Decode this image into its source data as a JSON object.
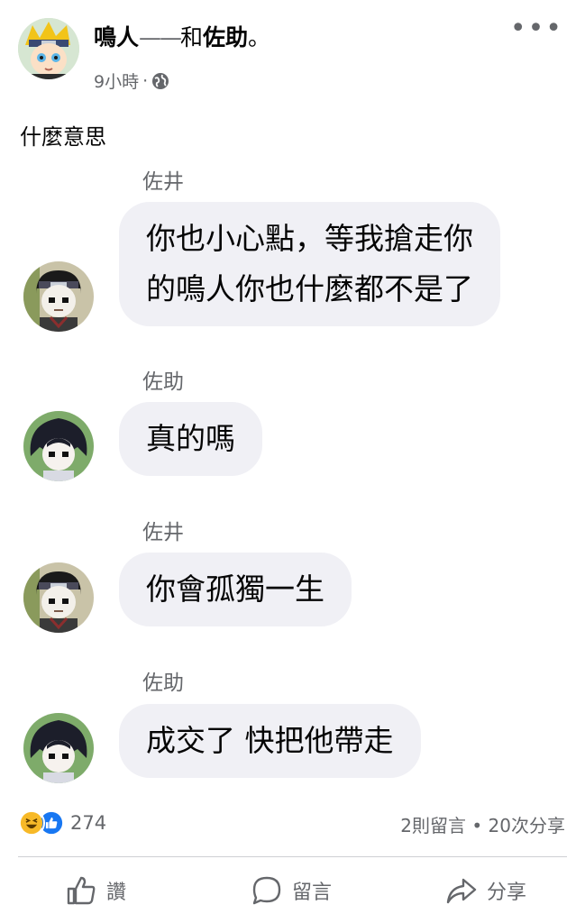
{
  "post": {
    "author_name": "鳴人",
    "separator": "——",
    "with_word": "和",
    "tagged_name": "佐助",
    "end_mark": "。",
    "time": "9小時",
    "dot": "·",
    "privacy_icon": "globe-icon",
    "more_label": "•••",
    "caption": "什麼意思"
  },
  "chat": {
    "messages": [
      {
        "sender": "佐井",
        "lines": [
          "你也小心點，等我搶走你",
          "的鳴人你也什麼都不是了"
        ]
      },
      {
        "sender": "佐助",
        "lines": [
          "真的嗎"
        ]
      },
      {
        "sender": "佐井",
        "lines": [
          "你會孤獨一生"
        ]
      },
      {
        "sender": "佐助",
        "lines": [
          "成交了 快把他帶走"
        ]
      }
    ]
  },
  "reactions": {
    "icons": [
      "laugh-reaction-icon",
      "like-reaction-icon"
    ],
    "count": "274",
    "comments": "2則留言",
    "bullet": "•",
    "shares": "20次分享"
  },
  "actions": {
    "like_label": "讚",
    "comment_label": "留言",
    "share_label": "分享"
  },
  "colors": {
    "bubble": "#f0f0f5",
    "secondary_text": "#65676b",
    "like_blue": "#1877f2",
    "haha_yellow": "#f7b928"
  }
}
